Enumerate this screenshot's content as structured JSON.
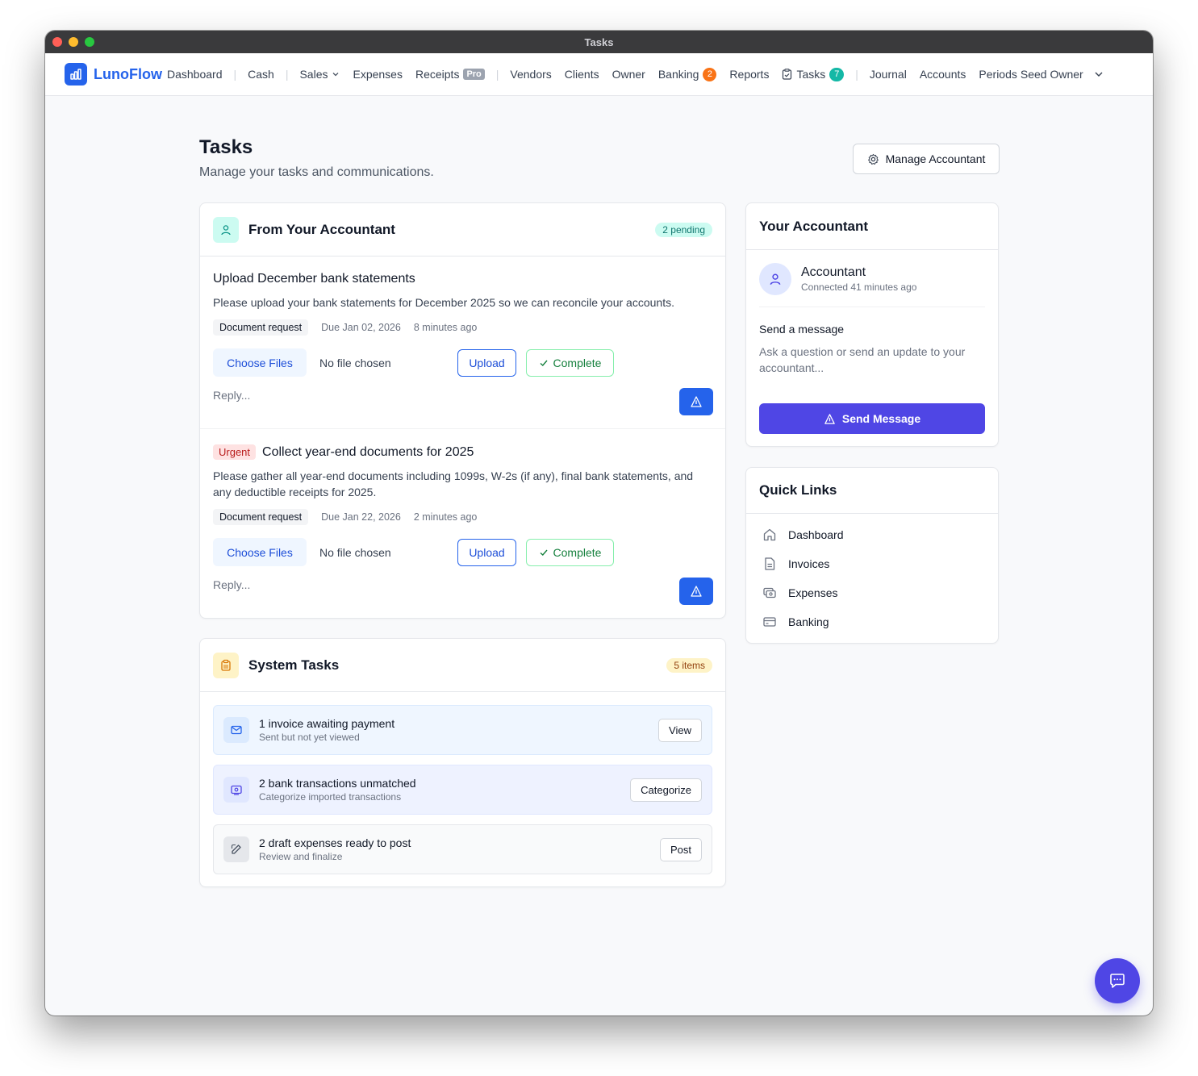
{
  "window": {
    "title": "Tasks"
  },
  "nav": {
    "brand": "LunoFlow",
    "items": {
      "dashboard": "Dashboard",
      "cash": "Cash",
      "sales": "Sales",
      "expenses": "Expenses",
      "receipts": "Receipts",
      "receipts_badge": "Pro",
      "vendors": "Vendors",
      "clients": "Clients",
      "owner": "Owner",
      "banking": "Banking",
      "banking_badge": "2",
      "reports": "Reports",
      "tasks": "Tasks",
      "tasks_badge": "7",
      "journal": "Journal",
      "accounts": "Accounts",
      "periods": "Periods"
    },
    "user": "Seed Owner",
    "separator": "|"
  },
  "page": {
    "title": "Tasks",
    "subtitle": "Manage your tasks and communications.",
    "manage_button": "Manage Accountant"
  },
  "from_accountant": {
    "title": "From Your Accountant",
    "pending": "2 pending",
    "tasks": [
      {
        "title": "Upload December bank statements",
        "description": "Please upload your bank statements for December 2025 so we can reconcile your accounts.",
        "type": "Document request",
        "due": "Due Jan 02, 2026",
        "ago": "8 minutes ago",
        "choose": "Choose Files",
        "file_status": "No file chosen",
        "upload": "Upload",
        "complete": "Complete",
        "reply_placeholder": "Reply..."
      },
      {
        "urgent": "Urgent",
        "title": "Collect year-end documents for 2025",
        "description": "Please gather all year-end documents including 1099s, W-2s (if any), final bank statements, and any deductible receipts for 2025.",
        "type": "Document request",
        "due": "Due Jan 22, 2026",
        "ago": "2 minutes ago",
        "choose": "Choose Files",
        "file_status": "No file chosen",
        "upload": "Upload",
        "complete": "Complete",
        "reply_placeholder": "Reply..."
      }
    ]
  },
  "system_tasks": {
    "title": "System Tasks",
    "count": "5 items",
    "items": [
      {
        "title": "1 invoice awaiting payment",
        "subtitle": "Sent but not yet viewed",
        "action": "View"
      },
      {
        "title": "2 bank transactions unmatched",
        "subtitle": "Categorize imported transactions",
        "action": "Categorize"
      },
      {
        "title": "2 draft expenses ready to post",
        "subtitle": "Review and finalize",
        "action": "Post"
      }
    ]
  },
  "your_accountant": {
    "title": "Your Accountant",
    "name": "Accountant",
    "status": "Connected 41 minutes ago",
    "message_label": "Send a message",
    "message_placeholder": "Ask a question or send an update to your accountant...",
    "send_button": "Send Message"
  },
  "quick_links": {
    "title": "Quick Links",
    "items": [
      "Dashboard",
      "Invoices",
      "Expenses",
      "Banking"
    ]
  },
  "colors": {
    "primary": "#2563eb",
    "indigo": "#4f46e5",
    "success": "#15803d",
    "urgent": "#b91c1c",
    "teal": "#14b8a6",
    "orange": "#f97316"
  }
}
